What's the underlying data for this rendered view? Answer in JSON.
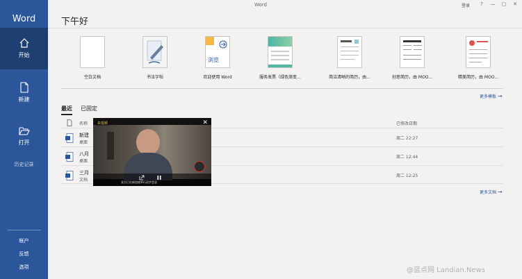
{
  "app": {
    "title": "Word"
  },
  "window": {
    "title": "Word",
    "signin_label": "登录",
    "help": "?",
    "minimize": "—",
    "restore": "▢",
    "close": "✕"
  },
  "sidebar": {
    "items": [
      {
        "label": "开始",
        "icon": "home-icon",
        "active": true
      },
      {
        "label": "新建",
        "icon": "new-document-icon"
      },
      {
        "label": "打开",
        "icon": "folder-open-icon"
      }
    ],
    "history_label": "历史记录",
    "bottom": [
      {
        "label": "帐户"
      },
      {
        "label": "反馈"
      },
      {
        "label": "选项"
      }
    ]
  },
  "main": {
    "greeting": "下午好",
    "templates": [
      {
        "label": "空白文档"
      },
      {
        "label": "书法字帖"
      },
      {
        "label": "欢迎使用 Word",
        "thumb_text": "浏览"
      },
      {
        "label": "服务发票（绿色渐变..."
      },
      {
        "label": "简洁清晰的简历，由..."
      },
      {
        "label": "创意简历，由 MOO..."
      },
      {
        "label": "精美简历，由 MOO..."
      }
    ],
    "more_templates": "更多模板",
    "tabs": [
      {
        "label": "最近"
      },
      {
        "label": "已固定"
      }
    ],
    "list_header": {
      "name": "名称",
      "date": "已修改日期"
    },
    "files": [
      {
        "name": "新建",
        "location": "桌面",
        "date": "周二 22:27"
      },
      {
        "name": "八月",
        "location": "桌面",
        "date": "周二 12:44"
      },
      {
        "name": "三月",
        "location": "文档",
        "date": "周二 12:25"
      }
    ],
    "more_docs": "更多文档"
  },
  "video": {
    "logo_text": "央视频",
    "close": "✕",
    "caption": "双方已在新加坡举行初步会谈"
  },
  "watermark": "@蓝点网 Landian.News",
  "colors": {
    "accent": "#2b579a",
    "accent_dark": "#1e3f70",
    "bg": "#f3f2f1"
  }
}
